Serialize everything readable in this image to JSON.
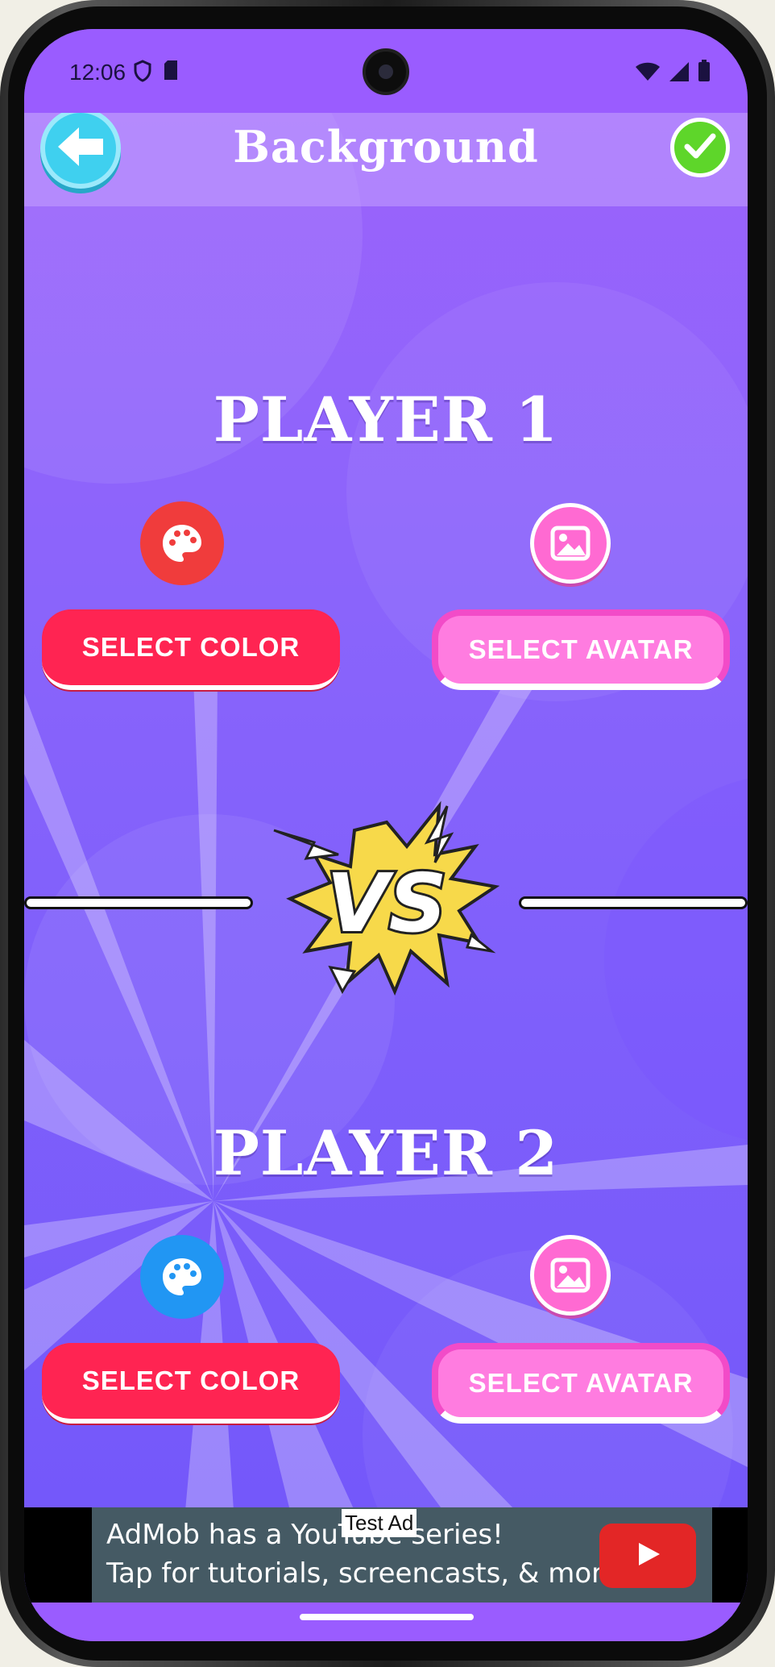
{
  "status_bar": {
    "time": "12:06",
    "left_icons": [
      "shield-icon",
      "sd-card-icon"
    ],
    "right_icons": [
      "wifi-icon",
      "signal-icon",
      "battery-icon"
    ]
  },
  "header": {
    "title": "Background",
    "back_icon": "arrow-left-icon",
    "confirm_icon": "check-icon"
  },
  "player1": {
    "label": "PLAYER 1",
    "select_color_label": "SELECT COLOR",
    "select_avatar_label": "SELECT AVATAR",
    "palette_color": "#f03c3c"
  },
  "versus": {
    "label": "VS"
  },
  "player2": {
    "label": "PLAYER 2",
    "select_color_label": "SELECT COLOR",
    "select_avatar_label": "SELECT AVATAR",
    "palette_color": "#2196f3"
  },
  "ad": {
    "badge": "Test Ad",
    "line1": "AdMob has a YouTube series!",
    "line2": "Tap for tutorials, screencasts, & more.",
    "icon": "youtube-play-icon"
  },
  "colors": {
    "accent_red": "#ff2452",
    "accent_pink": "#ff7ce0",
    "background_purple": "#8a64fb"
  }
}
